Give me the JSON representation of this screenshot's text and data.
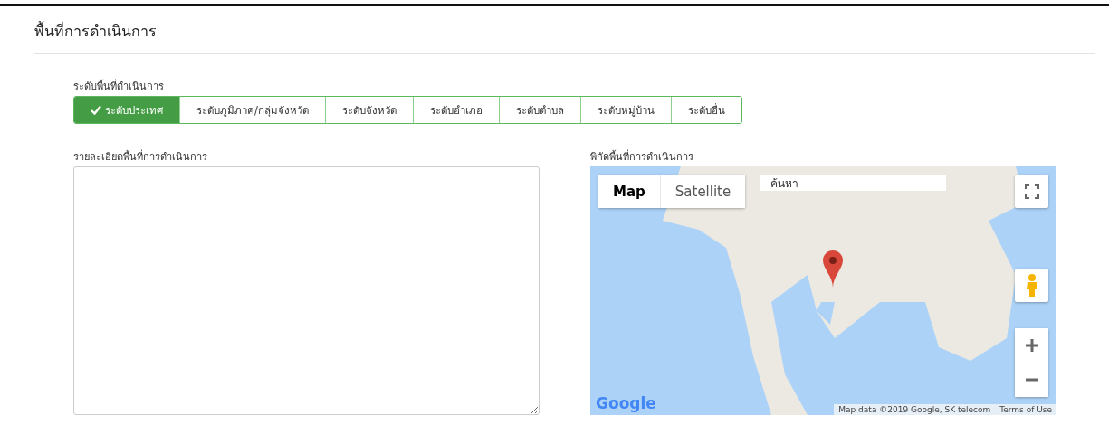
{
  "section": {
    "title": "พื้นที่การดำเนินการ"
  },
  "level_field": {
    "label": "ระดับพื้นที่ดำเนินการ",
    "options": [
      {
        "label": "ระดับประเทศ",
        "selected": true
      },
      {
        "label": "ระดับภูมิภาค/กลุ่มจังหวัด",
        "selected": false
      },
      {
        "label": "ระดับจังหวัด",
        "selected": false
      },
      {
        "label": "ระดับอำเภอ",
        "selected": false
      },
      {
        "label": "ระดับตำบล",
        "selected": false
      },
      {
        "label": "ระดับหมู่บ้าน",
        "selected": false
      },
      {
        "label": "ระดับอื่น",
        "selected": false
      }
    ]
  },
  "details_field": {
    "label": "รายละเอียดพื้นที่การดำเนินการ"
  },
  "map_field": {
    "label": "พิกัดพื้นที่การดำเนินการ",
    "map_types": [
      {
        "label": "Map",
        "selected": true
      },
      {
        "label": "Satellite",
        "selected": false
      }
    ],
    "search": {
      "placeholder": "ค้นหา"
    },
    "logo": "Google",
    "attribution": "Map data ©2019 Google, SK telecom",
    "terms": "Terms of Use"
  }
}
